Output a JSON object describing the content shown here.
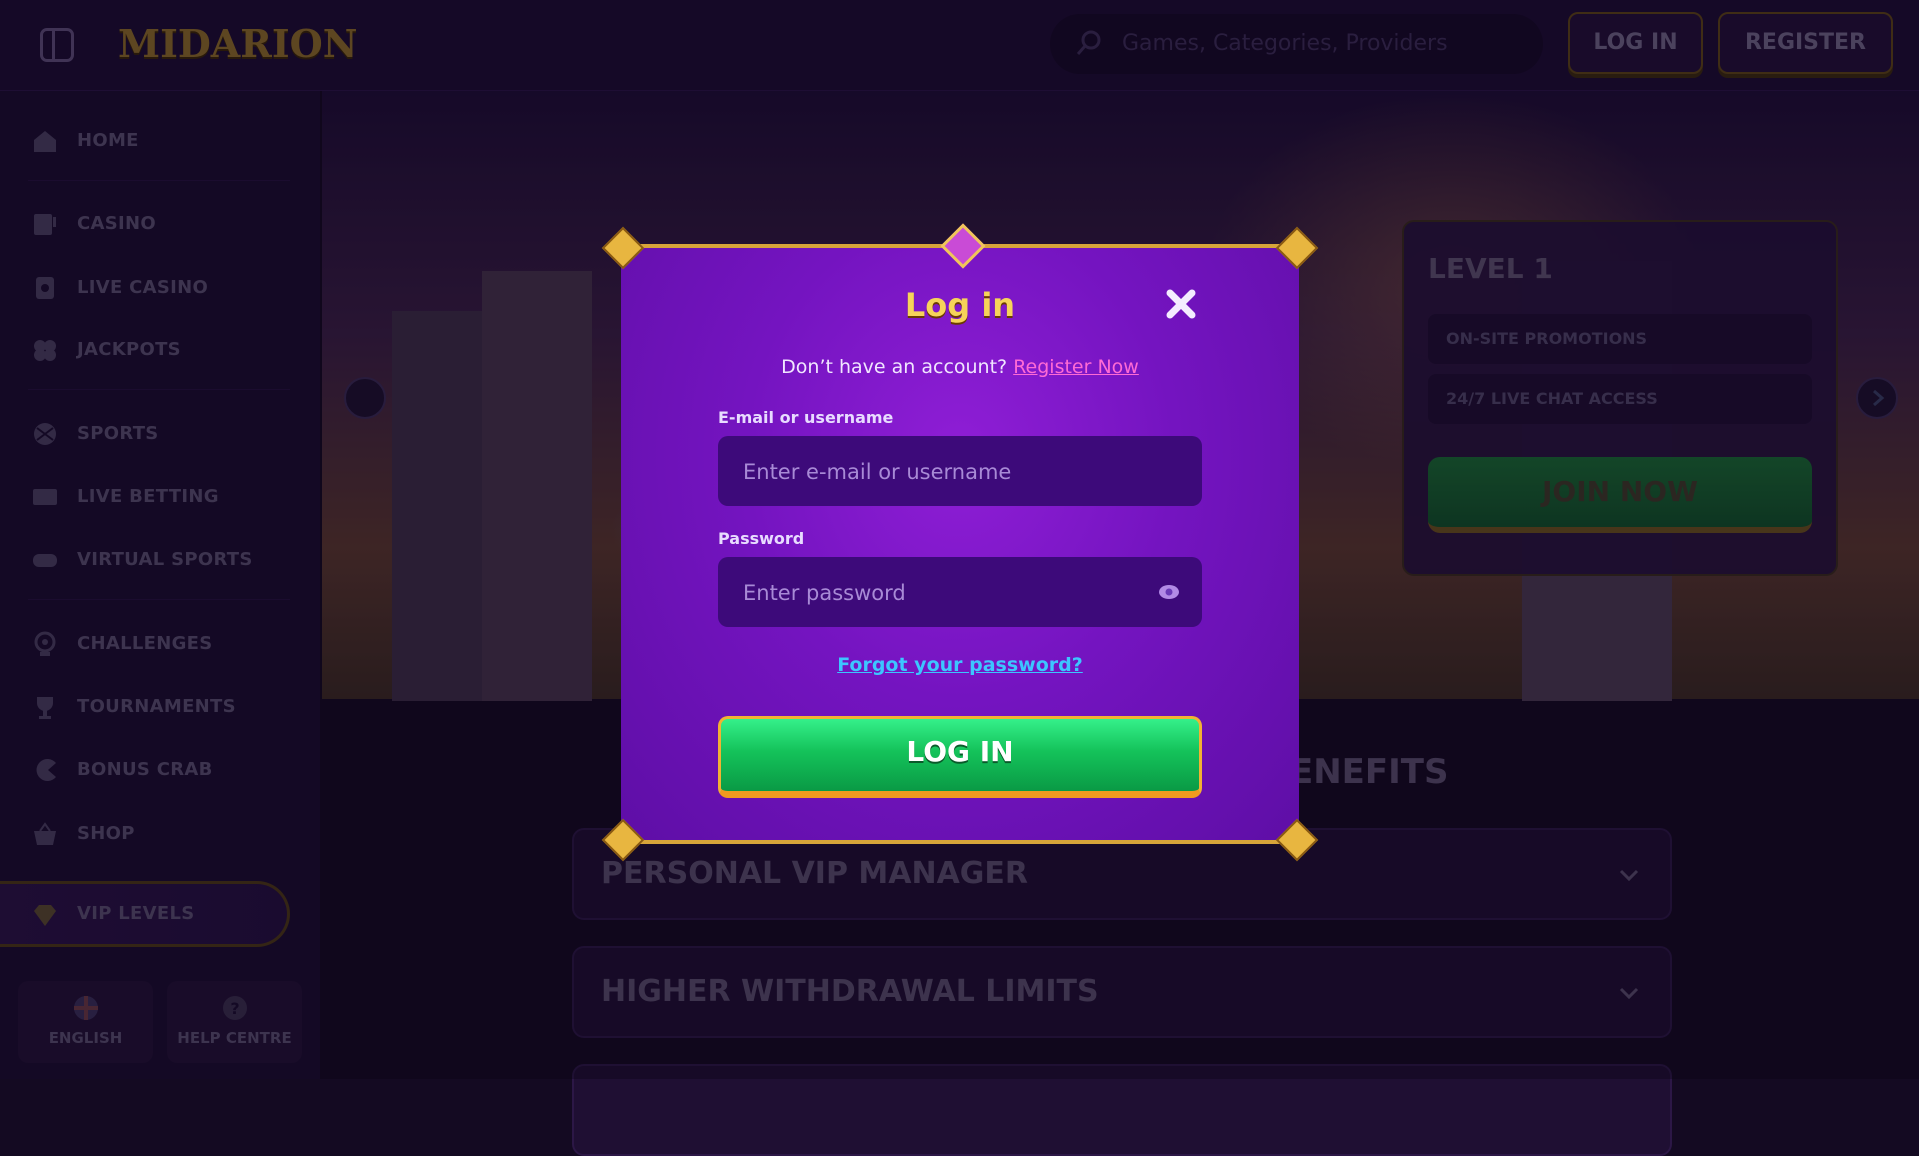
{
  "header": {
    "logo": "MIDARION",
    "search_placeholder": "Games, Categories, Providers",
    "login_label": "LOG IN",
    "register_label": "REGISTER"
  },
  "sidebar": {
    "items": [
      {
        "label": "HOME",
        "icon": "home-icon"
      },
      {
        "label": "CASINO",
        "icon": "slot-machine-icon"
      },
      {
        "label": "LIVE CASINO",
        "icon": "live-casino-icon"
      },
      {
        "label": "JACKPOTS",
        "icon": "clover-icon"
      },
      {
        "label": "SPORTS",
        "icon": "ball-icon"
      },
      {
        "label": "LIVE BETTING",
        "icon": "live-badge-icon"
      },
      {
        "label": "VIRTUAL SPORTS",
        "icon": "gamepad-icon"
      },
      {
        "label": "CHALLENGES",
        "icon": "target-icon"
      },
      {
        "label": "TOURNAMENTS",
        "icon": "trophy-icon"
      },
      {
        "label": "BONUS CRAB",
        "icon": "crab-claw-icon"
      },
      {
        "label": "SHOP",
        "icon": "basket-icon"
      },
      {
        "label": "VIP LEVELS",
        "icon": "diamond-icon"
      }
    ],
    "language": "ENGLISH",
    "help": "HELP CENTRE"
  },
  "banner": {
    "level_title": "LEVEL 1",
    "perks": [
      "ON-SITE PROMOTIONS",
      "24/7 LIVE CHAT ACCESS"
    ],
    "join_label": "JOIN NOW"
  },
  "benefits": {
    "title_fragment": "ENEFITS",
    "rows": [
      "PERSONAL VIP MANAGER",
      "HIGHER WITHDRAWAL LIMITS"
    ]
  },
  "modal": {
    "title": "Log in",
    "no_account_text": "Don’t have an account?",
    "register_link": "Register Now",
    "email_label": "E-mail or username",
    "email_placeholder": "Enter e-mail or username",
    "password_label": "Password",
    "password_placeholder": "Enter password",
    "forgot_link": "Forgot your password?",
    "submit_label": "LOG IN"
  },
  "colors": {
    "modal_purple": "#7414c0",
    "gold_border": "#d7a43a",
    "login_green": "#14c25a",
    "link_pink": "#ff6ad5",
    "link_blue": "#3cc6ff",
    "title_gold": "#f6d35a"
  }
}
